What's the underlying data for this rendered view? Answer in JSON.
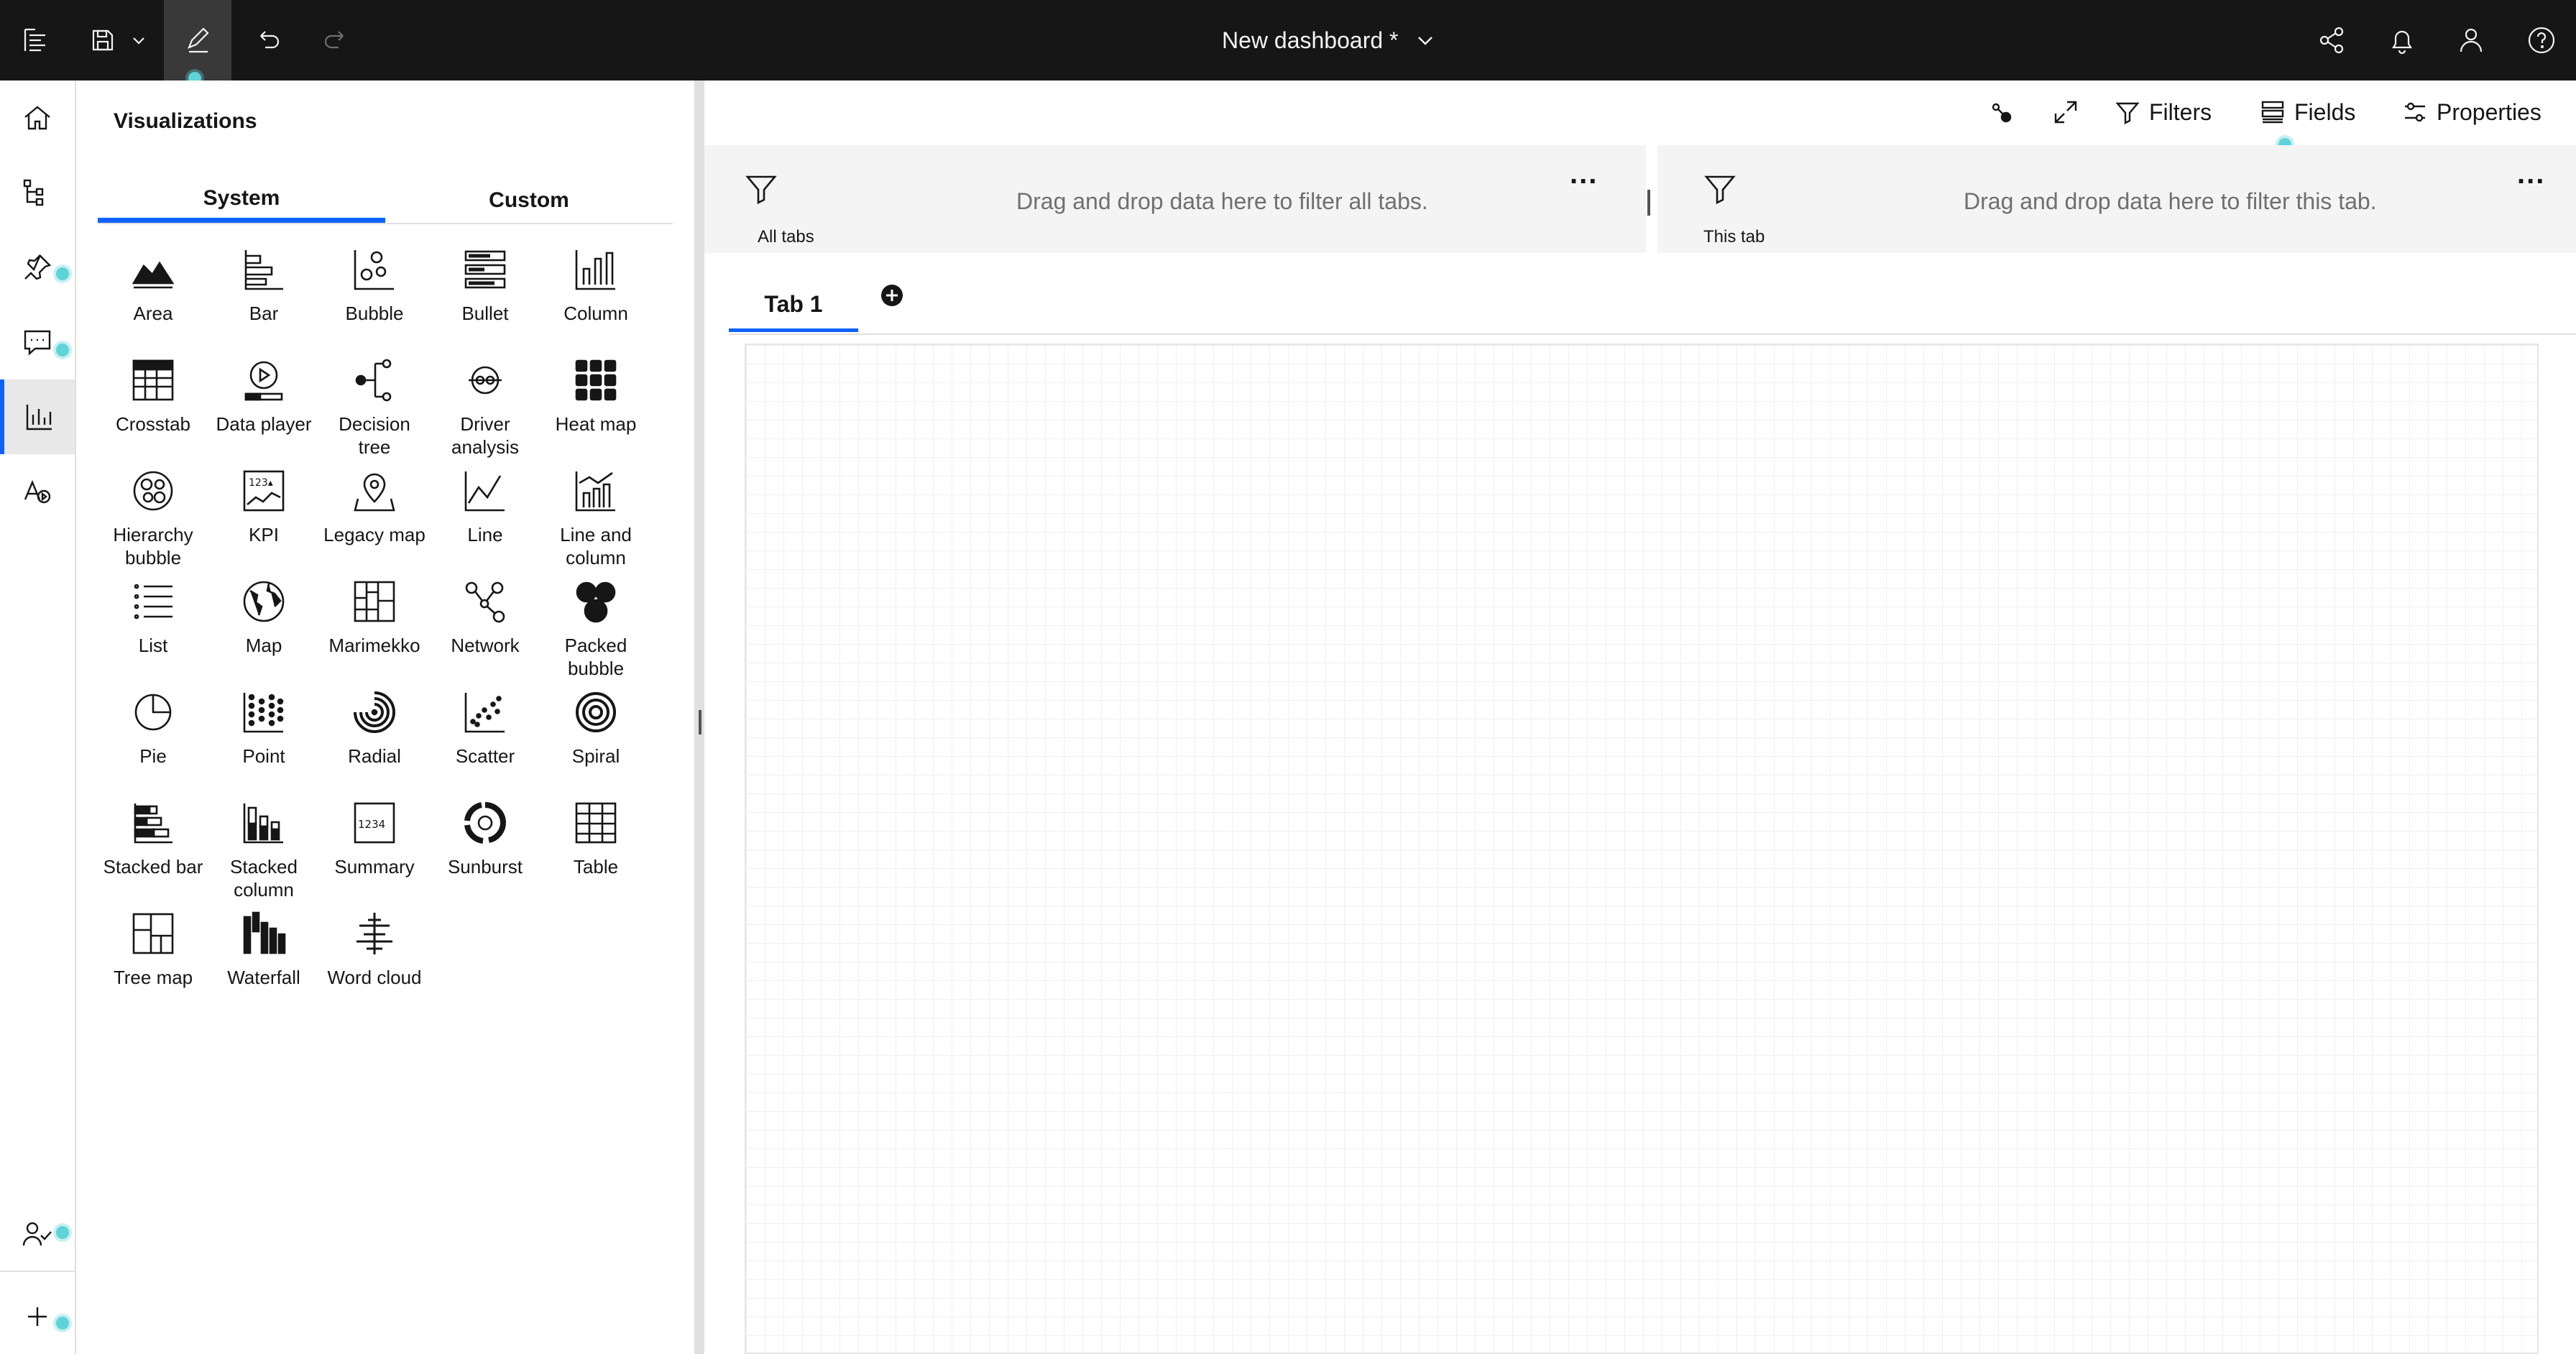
{
  "header": {
    "title": "New dashboard *",
    "icons": [
      "menu-icon",
      "save-icon",
      "chevron-down-icon",
      "edit-icon",
      "undo-icon",
      "redo-icon",
      "share-icon",
      "notification-icon",
      "user-icon",
      "help-icon"
    ]
  },
  "rail": {
    "items": [
      "home-icon",
      "data-sources-icon",
      "pin-icon",
      "chat-icon",
      "visualizations-icon",
      "assistant-icon",
      "user-check-icon",
      "add-icon"
    ]
  },
  "viz_panel": {
    "title": "Visualizations",
    "tabs": [
      {
        "label": "System"
      },
      {
        "label": "Custom"
      }
    ],
    "items": [
      {
        "label": "Area"
      },
      {
        "label": "Bar"
      },
      {
        "label": "Bubble"
      },
      {
        "label": "Bullet"
      },
      {
        "label": "Column"
      },
      {
        "label": "Crosstab"
      },
      {
        "label": "Data player"
      },
      {
        "label": "Decision tree"
      },
      {
        "label": "Driver analysis"
      },
      {
        "label": "Heat map"
      },
      {
        "label": "Hierarchy bubble"
      },
      {
        "label": "KPI"
      },
      {
        "label": "Legacy map"
      },
      {
        "label": "Line"
      },
      {
        "label": "Line and column"
      },
      {
        "label": "List"
      },
      {
        "label": "Map"
      },
      {
        "label": "Marimekko"
      },
      {
        "label": "Network"
      },
      {
        "label": "Packed bubble"
      },
      {
        "label": "Pie"
      },
      {
        "label": "Point"
      },
      {
        "label": "Radial"
      },
      {
        "label": "Scatter"
      },
      {
        "label": "Spiral"
      },
      {
        "label": "Stacked bar"
      },
      {
        "label": "Stacked column"
      },
      {
        "label": "Summary"
      },
      {
        "label": "Sunburst"
      },
      {
        "label": "Table"
      },
      {
        "label": "Tree map"
      },
      {
        "label": "Waterfall"
      },
      {
        "label": "Word cloud"
      }
    ]
  },
  "toolbar": {
    "filters_label": "Filters",
    "fields_label": "Fields",
    "properties_label": "Properties"
  },
  "filters": {
    "all_tabs_caption": "All tabs",
    "all_tabs_hint": "Drag and drop data here to filter all tabs.",
    "this_tab_caption": "This tab",
    "this_tab_hint": "Drag and drop data here to filter this tab.",
    "more": "..."
  },
  "tabs": [
    {
      "label": "Tab 1"
    }
  ],
  "colors": {
    "topbar": "#161616",
    "accent": "#0f62fe",
    "indicator": "#5fd3d8"
  }
}
